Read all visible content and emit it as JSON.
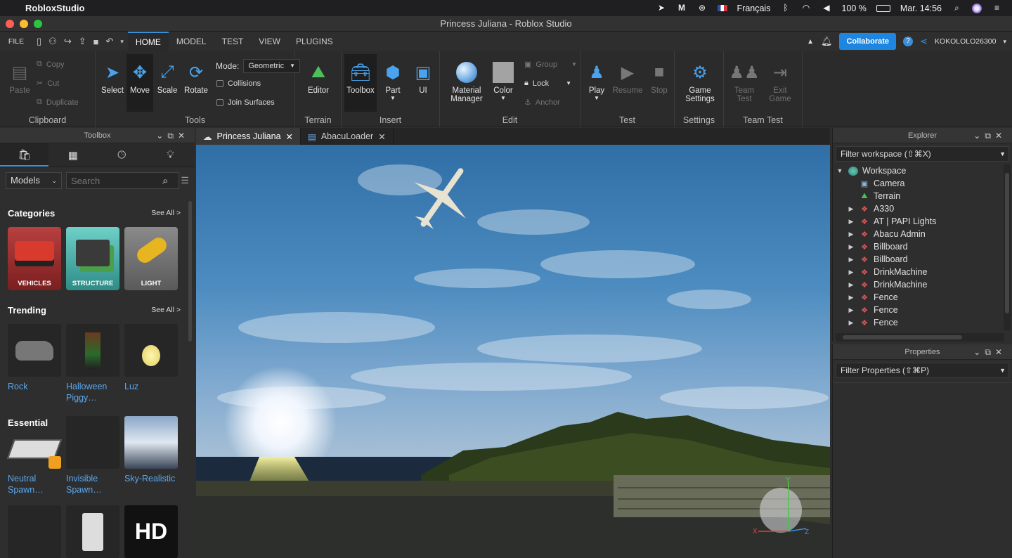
{
  "menubar": {
    "app_name": "RobloxStudio",
    "language": "Français",
    "battery": "100 %",
    "clock": "Mar. 14:56"
  },
  "window": {
    "title": "Princess Juliana - Roblox Studio"
  },
  "ribbon_tabs": {
    "file": "FILE",
    "items": [
      "HOME",
      "MODEL",
      "TEST",
      "VIEW",
      "PLUGINS"
    ],
    "active": "HOME",
    "collaborate": "Collaborate",
    "username": "KOKOLOLO26300"
  },
  "ribbon": {
    "clipboard": {
      "label": "Clipboard",
      "paste": "Paste",
      "copy": "Copy",
      "cut": "Cut",
      "duplicate": "Duplicate"
    },
    "tools": {
      "label": "Tools",
      "select": "Select",
      "move": "Move",
      "scale": "Scale",
      "rotate": "Rotate",
      "mode_label": "Mode:",
      "mode_value": "Geometric",
      "collisions": "Collisions",
      "join_surfaces": "Join Surfaces"
    },
    "terrain": {
      "label": "Terrain",
      "editor": "Editor"
    },
    "insert": {
      "label": "Insert",
      "toolbox": "Toolbox",
      "part": "Part",
      "ui": "UI"
    },
    "edit": {
      "label": "Edit",
      "material_manager_1": "Material",
      "material_manager_2": "Manager",
      "color": "Color",
      "group": "Group",
      "lock": "Lock",
      "anchor": "Anchor"
    },
    "test": {
      "label": "Test",
      "play": "Play",
      "resume": "Resume",
      "stop": "Stop"
    },
    "settings": {
      "label": "Settings",
      "game_settings_1": "Game",
      "game_settings_2": "Settings"
    },
    "team_test": {
      "label": "Team Test",
      "team_test_1": "Team",
      "team_test_2": "Test",
      "exit_game_1": "Exit",
      "exit_game_2": "Game"
    }
  },
  "toolbox": {
    "title": "Toolbox",
    "category_select": "Models",
    "search_placeholder": "Search",
    "categories_heading": "Categories",
    "see_all": "See All >",
    "categories": [
      "VEHICLES",
      "STRUCTURE",
      "LIGHT"
    ],
    "trending_heading": "Trending",
    "trending": [
      {
        "line1": "Rock",
        "line2": ""
      },
      {
        "line1": "Halloween",
        "line2": "Piggy…"
      },
      {
        "line1": "Luz",
        "line2": ""
      }
    ],
    "essential_heading": "Essential",
    "essential": [
      {
        "line1": "Neutral",
        "line2": "Spawn…"
      },
      {
        "line1": "Invisible",
        "line2": "Spawn…"
      },
      {
        "line1": "Sky-Realistic",
        "line2": ""
      }
    ],
    "hd_badge": "HD"
  },
  "doc_tabs": [
    {
      "label": "Princess Juliana"
    },
    {
      "label": "AbacuLoader"
    }
  ],
  "viewport": {
    "gizmo_axes": [
      "X",
      "Y",
      "Z"
    ]
  },
  "explorer": {
    "title": "Explorer",
    "filter": "Filter workspace (⇧⌘X)",
    "workspace": "Workspace",
    "children": [
      "Camera",
      "Terrain",
      "A330",
      "AT | PAPI Lights",
      "Abacu Admin",
      "Billboard",
      "Billboard",
      "DrinkMachine",
      "DrinkMachine",
      "Fence",
      "Fence",
      "Fence"
    ]
  },
  "properties": {
    "title": "Properties",
    "filter": "Filter Properties (⇧⌘P)"
  },
  "colors": {
    "accent": "#1e86e0",
    "link": "#5aa8f0",
    "panel": "#2e2e2e"
  }
}
